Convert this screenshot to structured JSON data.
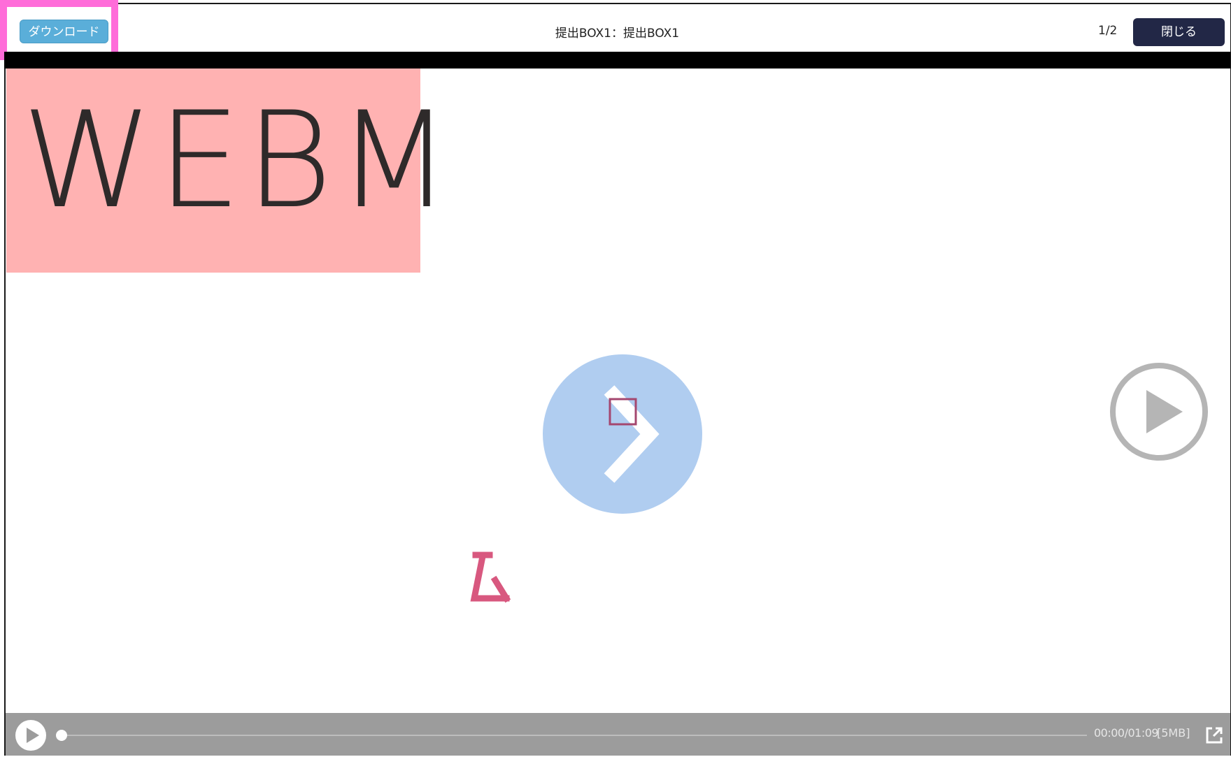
{
  "header": {
    "download_label": "ダウンロード",
    "title": "提出BOX1：提出BOX1",
    "page_counter": "1/2",
    "close_label": "閉じる"
  },
  "video": {
    "badge_text": "WEBM",
    "current_time": "00:00",
    "duration": "01:09",
    "time_display": "00:00/01:09",
    "file_size": "[5MB]",
    "progress_fraction": 0.0
  },
  "icons": {
    "center": "chevron-right-icon",
    "side_play": "play-circle-icon",
    "control_play": "play-icon",
    "external": "external-link-icon"
  },
  "colors": {
    "download_button": "#5aaed9",
    "close_button": "#222746",
    "highlight_outline": "#ff6cd9",
    "webm_badge": "#ffb2b2",
    "center_circle": "#b0cdf0",
    "controls_bar": "#9c9c9c"
  }
}
